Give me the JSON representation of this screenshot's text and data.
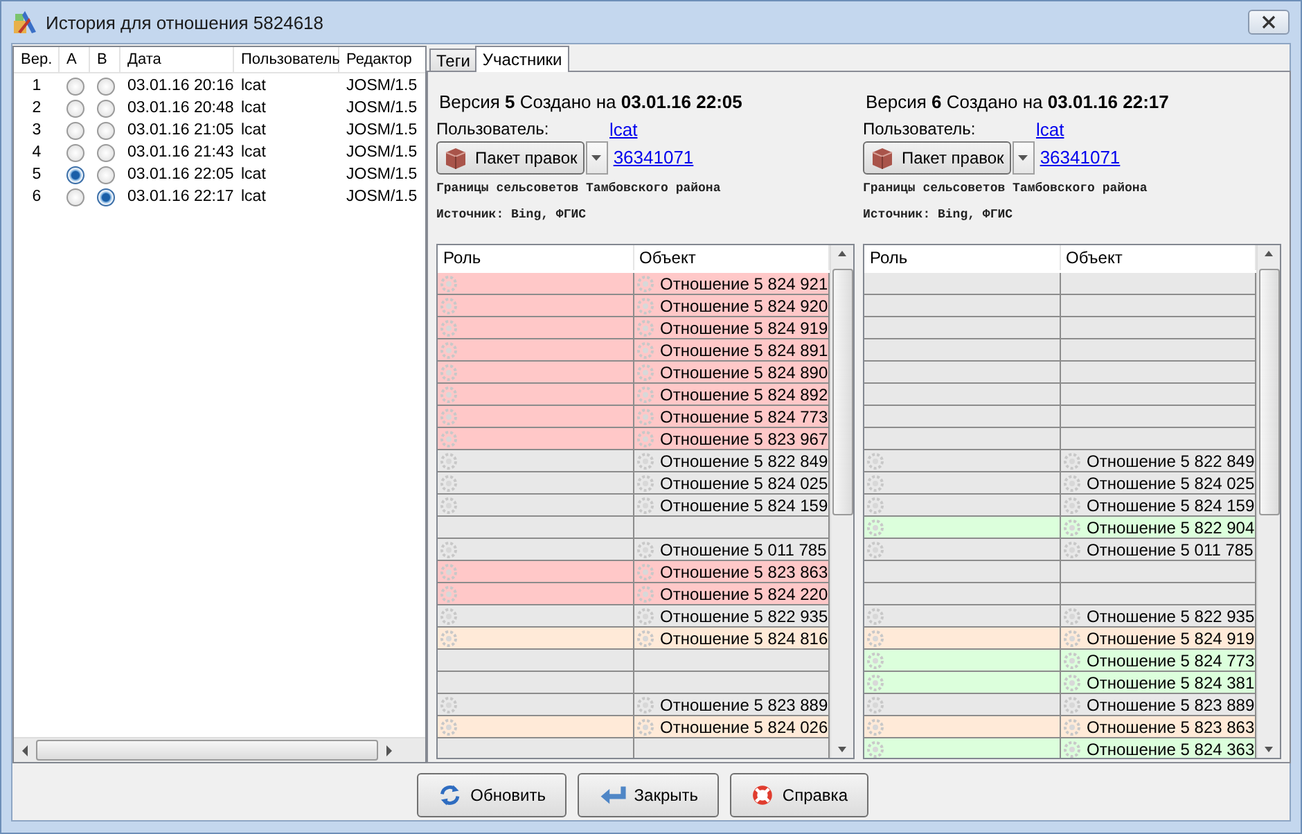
{
  "window": {
    "title": "История для отношения 5824618"
  },
  "history": {
    "columns": [
      "Вер.",
      "A",
      "B",
      "Дата",
      "Пользователь",
      "Редактор"
    ],
    "rows": [
      {
        "version": "1",
        "radio_a": {
          "selected": false
        },
        "radio_b": {
          "selected": false
        },
        "date": "03.01.16 20:16",
        "user": "lcat",
        "editor": "JOSM/1.5"
      },
      {
        "version": "2",
        "radio_a": {
          "selected": false
        },
        "radio_b": {
          "selected": false
        },
        "date": "03.01.16 20:48",
        "user": "lcat",
        "editor": "JOSM/1.5"
      },
      {
        "version": "3",
        "radio_a": {
          "selected": false
        },
        "radio_b": {
          "selected": false
        },
        "date": "03.01.16 21:05",
        "user": "lcat",
        "editor": "JOSM/1.5"
      },
      {
        "version": "4",
        "radio_a": {
          "selected": false
        },
        "radio_b": {
          "selected": false
        },
        "date": "03.01.16 21:43",
        "user": "lcat",
        "editor": "JOSM/1.5"
      },
      {
        "version": "5",
        "radio_a": {
          "selected": true
        },
        "radio_b": {
          "selected": false
        },
        "date": "03.01.16 22:05",
        "user": "lcat",
        "editor": "JOSM/1.5"
      },
      {
        "version": "6",
        "radio_a": {
          "selected": false
        },
        "radio_b": {
          "selected": true
        },
        "date": "03.01.16 22:17",
        "user": "lcat",
        "editor": "JOSM/1.5"
      }
    ]
  },
  "tabs": [
    {
      "label": "Теги",
      "selected": false
    },
    {
      "label": "Участники",
      "selected": true
    }
  ],
  "versions": [
    {
      "heading": "Версия **5** Создано на **03.01.16 22:05**",
      "user_label": "Пользователь:",
      "user": "lcat",
      "changeset_button": "Пакет правок",
      "changeset": "36341071",
      "comment": "Границы сельсоветов Тамбовского района",
      "source": "Источник: Bing, ФГИС",
      "columns": [
        "Роль",
        "Объект"
      ],
      "rows": [
        {
          "kind": "deleted",
          "object": "Отношение 5 824 921"
        },
        {
          "kind": "deleted",
          "object": "Отношение 5 824 920"
        },
        {
          "kind": "deleted",
          "object": "Отношение 5 824 919"
        },
        {
          "kind": "deleted",
          "object": "Отношение 5 824 891"
        },
        {
          "kind": "deleted",
          "object": "Отношение 5 824 890"
        },
        {
          "kind": "deleted",
          "object": "Отношение 5 824 892"
        },
        {
          "kind": "deleted",
          "object": "Отношение 5 824 773"
        },
        {
          "kind": "deleted",
          "object": "Отношение 5 823 967"
        },
        {
          "kind": "same",
          "object": "Отношение 5 822 849"
        },
        {
          "kind": "same",
          "object": "Отношение 5 824 025"
        },
        {
          "kind": "same",
          "object": "Отношение 5 824 159"
        },
        {
          "kind": "empty"
        },
        {
          "kind": "same",
          "object": "Отношение 5 011 785"
        },
        {
          "kind": "deleted",
          "object": "Отношение 5 823 863"
        },
        {
          "kind": "deleted",
          "object": "Отношение 5 824 220"
        },
        {
          "kind": "same",
          "object": "Отношение 5 822 935"
        },
        {
          "kind": "changed",
          "object": "Отношение 5 824 816"
        },
        {
          "kind": "empty"
        },
        {
          "kind": "empty"
        },
        {
          "kind": "same",
          "object": "Отношение 5 823 889"
        },
        {
          "kind": "changed",
          "object": "Отношение 5 824 026"
        },
        {
          "kind": "empty"
        }
      ]
    },
    {
      "heading": "Версия **6** Создано на **03.01.16 22:17**",
      "user_label": "Пользователь:",
      "user": "lcat",
      "changeset_button": "Пакет правок",
      "changeset": "36341071",
      "comment": "Границы сельсоветов Тамбовского района",
      "source": "Источник: Bing, ФГИС",
      "columns": [
        "Роль",
        "Объект"
      ],
      "rows": [
        {
          "kind": "empty"
        },
        {
          "kind": "empty"
        },
        {
          "kind": "empty"
        },
        {
          "kind": "empty"
        },
        {
          "kind": "empty"
        },
        {
          "kind": "empty"
        },
        {
          "kind": "empty"
        },
        {
          "kind": "empty"
        },
        {
          "kind": "same",
          "object": "Отношение 5 822 849"
        },
        {
          "kind": "same",
          "object": "Отношение 5 824 025"
        },
        {
          "kind": "same",
          "object": "Отношение 5 824 159"
        },
        {
          "kind": "added",
          "object": "Отношение 5 822 904"
        },
        {
          "kind": "same",
          "object": "Отношение 5 011 785"
        },
        {
          "kind": "empty"
        },
        {
          "kind": "empty"
        },
        {
          "kind": "same",
          "object": "Отношение 5 822 935"
        },
        {
          "kind": "changed",
          "object": "Отношение 5 824 919"
        },
        {
          "kind": "added",
          "object": "Отношение 5 824 773"
        },
        {
          "kind": "added",
          "object": "Отношение 5 824 381"
        },
        {
          "kind": "same",
          "object": "Отношение 5 823 889"
        },
        {
          "kind": "changed",
          "object": "Отношение 5 823 863"
        },
        {
          "kind": "added",
          "object": "Отношение 5 824 363"
        }
      ]
    }
  ],
  "buttons": [
    {
      "kind": "refresh",
      "label": "Обновить"
    },
    {
      "kind": "close",
      "label": "Закрыть"
    },
    {
      "kind": "help",
      "label": "Справка"
    }
  ]
}
